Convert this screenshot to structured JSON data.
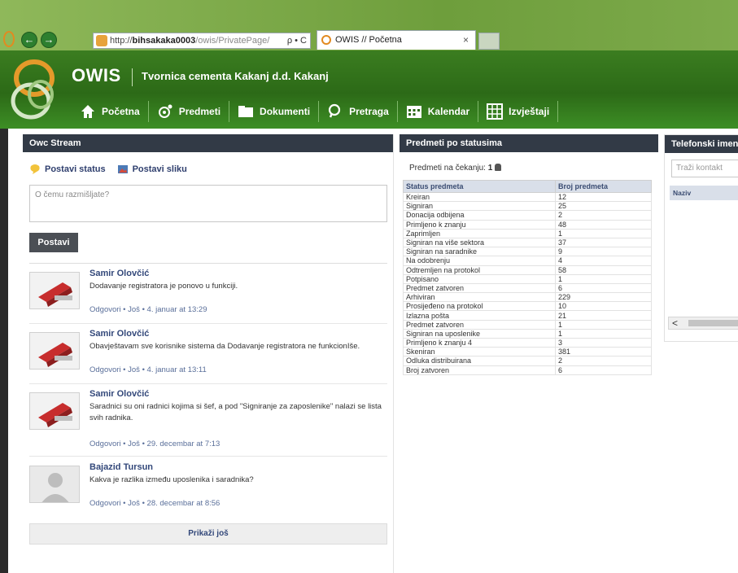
{
  "browser": {
    "address": {
      "protocol": "http://",
      "host": "bihsakaka0003",
      "path": "/owis/PrivatePage/",
      "controls": "ρ • C"
    },
    "tab": {
      "title": "OWIS // Početna",
      "close": "×"
    },
    "back_symbol": "←",
    "forward_symbol": "→"
  },
  "app": {
    "brand": "OWIS",
    "company": "Tvornica cementa Kakanj d.d. Kakanj",
    "colors": {
      "header_green": "#2c6a17",
      "panel_head": "#323a46",
      "link_blue": "#33487a"
    },
    "nav": [
      {
        "label": "Početna",
        "icon": "home-icon"
      },
      {
        "label": "Predmeti",
        "icon": "cases-icon"
      },
      {
        "label": "Dokumenti",
        "icon": "folder-icon"
      },
      {
        "label": "Pretraga",
        "icon": "search-icon"
      },
      {
        "label": "Kalendar",
        "icon": "calendar-icon"
      },
      {
        "label": "Izvještaji",
        "icon": "reports-icon"
      }
    ]
  },
  "stream": {
    "title": "Owc Stream",
    "set_status": "Postavi status",
    "set_image": "Postavi sliku",
    "input_placeholder": "O čemu razmišljate?",
    "post_button": "Postavi",
    "posts": [
      {
        "author": "Samir Olovčić",
        "text": "Dodavanje registratora je ponovo u funkciji.",
        "meta": "Odgovori • Još • 4. januar at 13:29"
      },
      {
        "author": "Samir Olovčić",
        "text": "Obavještavam sve korisnike sistema da Dodavanje registratora ne funkcionIše.",
        "meta": "Odgovori • Još • 4. januar at 13:11"
      },
      {
        "author": "Samir Olovčić",
        "text": "Saradnici su oni radnici kojima si šef, a pod \"Signiranje za zaposlenike\" nalazi se lista svih radnika.",
        "meta": "Odgovori • Još • 29. decembar at 7:13"
      },
      {
        "author": "Bajazid Tursun",
        "text": "Kakva je razlika između uposlenika i saradnika?",
        "meta": "Odgovori • Još • 28. decembar at 8:56"
      }
    ],
    "more_button": "Prikaži još"
  },
  "statuses": {
    "title": "Predmeti po statusima",
    "waiting_label": "Predmeti na čekanju:",
    "waiting_count": "1",
    "columns": [
      "Status predmeta",
      "Broj predmeta"
    ],
    "rows": [
      [
        "Kreiran",
        "12"
      ],
      [
        "Signiran",
        "25"
      ],
      [
        "Donacija odbijena",
        "2"
      ],
      [
        "Primljeno k znanju",
        "48"
      ],
      [
        "Zaprimljen",
        "1"
      ],
      [
        "Signiran na više sektora",
        "37"
      ],
      [
        "Signiran na saradnike",
        "9"
      ],
      [
        "Na odobrenju",
        "4"
      ],
      [
        "Odtremljen na protokol",
        "58"
      ],
      [
        "Potpisano",
        "1"
      ],
      [
        "Predmet zatvoren",
        "6"
      ],
      [
        "Arhiviran",
        "229"
      ],
      [
        "Prosijeđeno na protokol",
        "10"
      ],
      [
        "Izlazna pošta",
        "21"
      ],
      [
        "Predmet zatvoren",
        "1"
      ],
      [
        "Signiran na uposlenike",
        "1"
      ],
      [
        "Primljeno k znanju 4",
        "3"
      ],
      [
        "Skeniran",
        "381"
      ],
      [
        "Odluka distribuirana",
        "2"
      ],
      [
        "Broj zatvoren",
        "6"
      ]
    ]
  },
  "phones": {
    "title": "Telefonski imenik",
    "search_placeholder": "Traži kontakt",
    "column": "Naziv",
    "scroll_left": "<"
  }
}
